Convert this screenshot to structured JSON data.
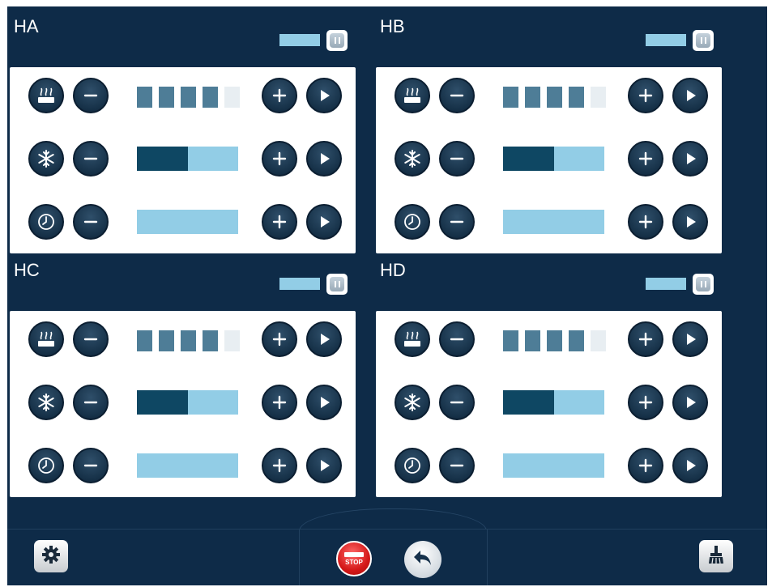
{
  "colors": {
    "background": "#0e2b48",
    "panel": "#ffffff",
    "button_dark": "#163148",
    "bar_light": "#92cde6",
    "bar_dark": "#0e4763",
    "segment_on": "#4e7d97",
    "segment_off": "#e8eef2",
    "stop_red": "#d41818"
  },
  "zones": [
    {
      "id": "ha",
      "title": "HA",
      "rows": [
        {
          "kind": "level",
          "icon": "steam-heater-icon",
          "segments_on": 4,
          "segments_total": 5
        },
        {
          "kind": "cooling",
          "icon": "snowflake-icon",
          "level_fraction": 0.5
        },
        {
          "kind": "timer",
          "icon": "clock-icon",
          "level_fraction": 0.0
        }
      ]
    },
    {
      "id": "hb",
      "title": "HB",
      "rows": [
        {
          "kind": "level",
          "icon": "steam-heater-icon",
          "segments_on": 4,
          "segments_total": 5
        },
        {
          "kind": "cooling",
          "icon": "snowflake-icon",
          "level_fraction": 0.5
        },
        {
          "kind": "timer",
          "icon": "clock-icon",
          "level_fraction": 0.0
        }
      ]
    },
    {
      "id": "hc",
      "title": "HC",
      "rows": [
        {
          "kind": "level",
          "icon": "steam-heater-icon",
          "segments_on": 4,
          "segments_total": 5
        },
        {
          "kind": "cooling",
          "icon": "snowflake-icon",
          "level_fraction": 0.5
        },
        {
          "kind": "timer",
          "icon": "clock-icon",
          "level_fraction": 0.0
        }
      ]
    },
    {
      "id": "hd",
      "title": "HD",
      "rows": [
        {
          "kind": "level",
          "icon": "steam-heater-icon",
          "segments_on": 4,
          "segments_total": 5
        },
        {
          "kind": "cooling",
          "icon": "snowflake-icon",
          "level_fraction": 0.5
        },
        {
          "kind": "timer",
          "icon": "clock-icon",
          "level_fraction": 0.0
        }
      ]
    }
  ],
  "bottom_bar": {
    "settings_icon": "gear-icon",
    "stop_label": "STOP",
    "back_icon": "back-arrow-icon",
    "clean_icon": "broom-icon"
  }
}
